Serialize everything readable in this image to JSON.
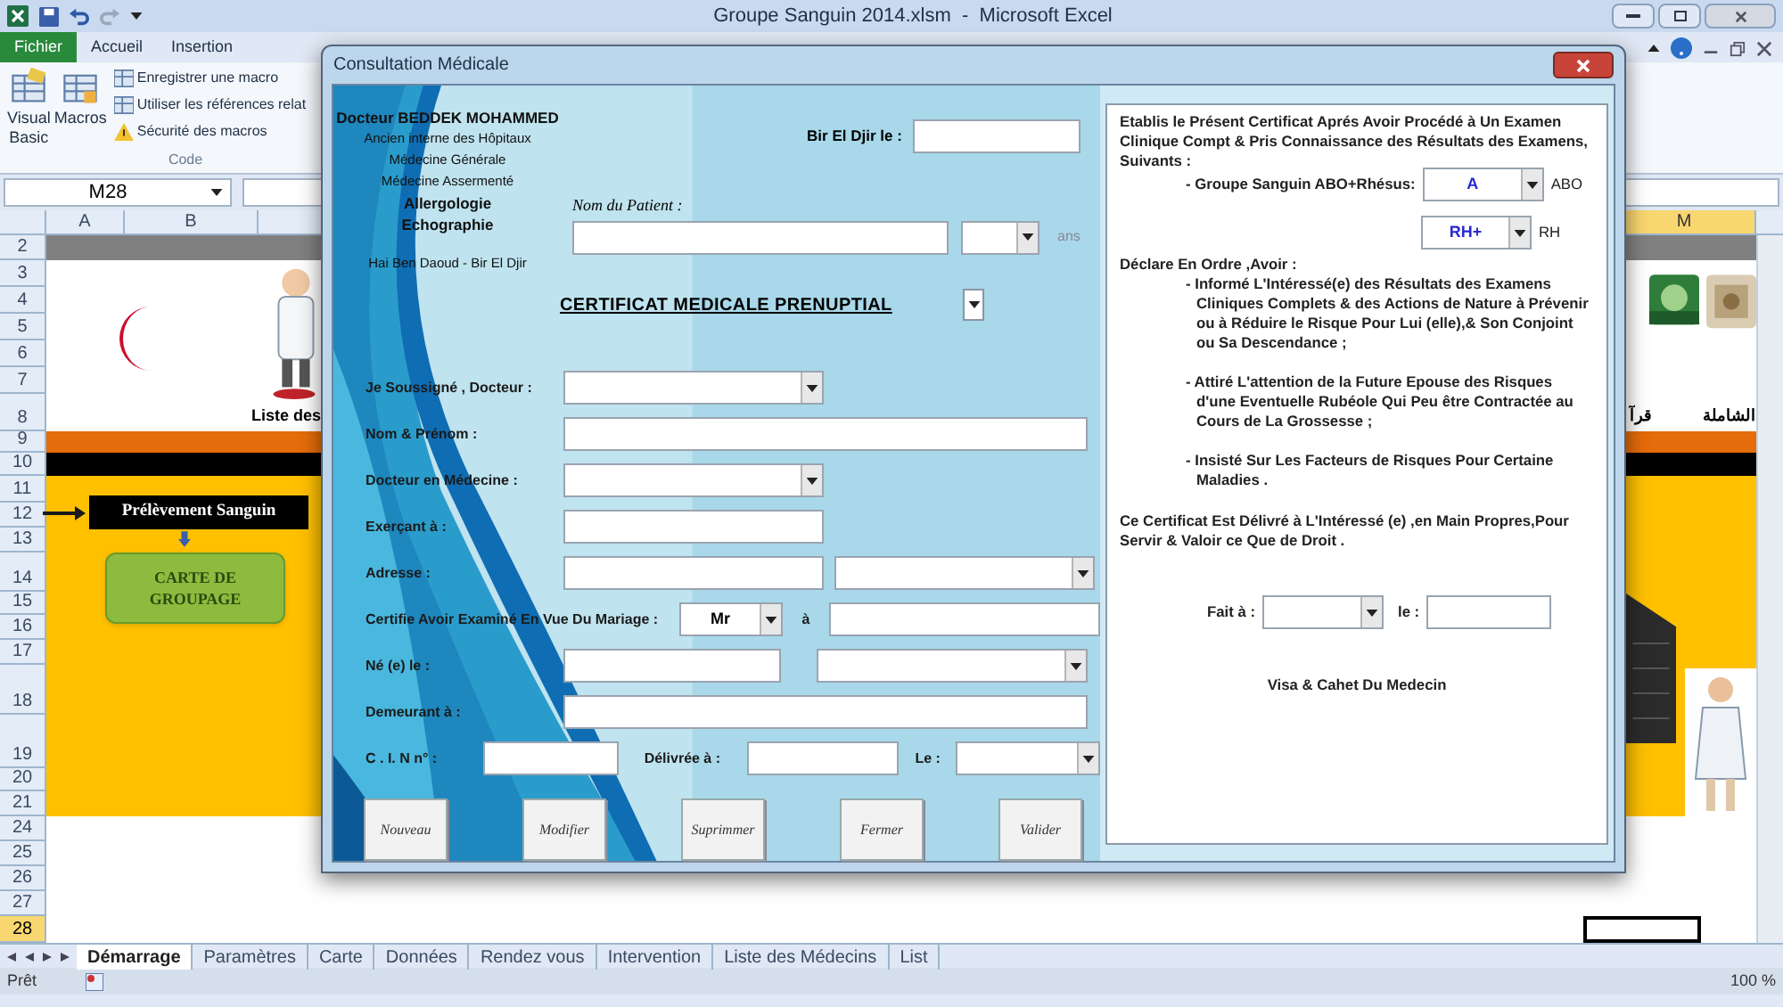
{
  "window": {
    "title": "Groupe Sanguin 2014.xlsm  -  Microsoft Excel"
  },
  "ribbon_tabs": [
    {
      "label": "Fichier",
      "selected": true
    },
    {
      "label": "Accueil",
      "selected": false
    },
    {
      "label": "Insertion",
      "selected": false
    }
  ],
  "ribbon": {
    "large_buttons": [
      "Visual Basic",
      "Macros"
    ],
    "small_buttons": [
      "Enregistrer une macro",
      "Utiliser les références relat",
      "Sécurité des macros"
    ],
    "group": "Code"
  },
  "name_box": "M28",
  "columns": [
    {
      "label": "A",
      "selected": false
    },
    {
      "label": "B",
      "selected": false
    },
    {
      "label": "M",
      "selected": true
    }
  ],
  "rows": [
    {
      "label": "2",
      "kind": "gray",
      "selected": false
    },
    {
      "label": "3",
      "kind": "white",
      "selected": false
    },
    {
      "label": "4",
      "kind": "white",
      "selected": false
    },
    {
      "label": "5",
      "kind": "white",
      "selected": false
    },
    {
      "label": "6",
      "kind": "white",
      "selected": false
    },
    {
      "label": "7",
      "kind": "white",
      "selected": false
    },
    {
      "label": "8",
      "kind": "white",
      "selected": false
    },
    {
      "label": "9",
      "kind": "orange",
      "selected": false
    },
    {
      "label": "10",
      "kind": "black",
      "selected": false
    },
    {
      "label": "11",
      "kind": "yellow",
      "selected": false
    },
    {
      "label": "12",
      "kind": "yellow",
      "selected": false
    },
    {
      "label": "13",
      "kind": "yellow",
      "selected": false
    },
    {
      "label": "14",
      "kind": "yellow",
      "selected": false
    },
    {
      "label": "15",
      "kind": "yellow",
      "selected": false
    },
    {
      "label": "16",
      "kind": "yellow",
      "selected": false
    },
    {
      "label": "17",
      "kind": "yellow",
      "selected": false
    },
    {
      "label": "18",
      "kind": "yellow",
      "selected": false
    },
    {
      "label": "19",
      "kind": "yellow",
      "selected": false
    },
    {
      "label": "20",
      "kind": "yellow",
      "selected": false
    },
    {
      "label": "21",
      "kind": "yellow",
      "selected": false
    },
    {
      "label": "24",
      "kind": "white",
      "selected": false
    },
    {
      "label": "25",
      "kind": "white",
      "selected": false
    },
    {
      "label": "26",
      "kind": "white",
      "selected": false
    },
    {
      "label": "27",
      "kind": "white",
      "selected": false
    },
    {
      "label": "28",
      "kind": "white",
      "selected": true
    }
  ],
  "sheet": {
    "caption": "Liste des",
    "arabic_labels": [
      "الشاملة",
      "قرآ"
    ],
    "flow_label": "Prélèvement Sanguin",
    "card_button": "CARTE DE GROUPAGE"
  },
  "sheet_tabs": [
    {
      "label": "Démarrage",
      "selected": true
    },
    {
      "label": "Paramètres",
      "selected": false
    },
    {
      "label": "Carte",
      "selected": false
    },
    {
      "label": "Données",
      "selected": false
    },
    {
      "label": "Rendez vous",
      "selected": false
    },
    {
      "label": "Intervention",
      "selected": false
    },
    {
      "label": "Liste des Médecins",
      "selected": false
    },
    {
      "label": "List",
      "selected": false
    }
  ],
  "status_bar": {
    "text": "Prêt",
    "zoom": "100 %"
  },
  "dialog": {
    "title": "Consultation Médicale",
    "doctor_card": [
      {
        "text": "Docteur BEDDEK MOHAMMED",
        "bold": true
      },
      {
        "text": "Ancien interne des Hôpitaux",
        "bold": false
      },
      {
        "text": "Médecine Générale",
        "bold": false
      },
      {
        "text": "Médecine Assermenté",
        "bold": false
      },
      {
        "text": "Allergologie",
        "bold": true
      },
      {
        "text": "Echographie",
        "bold": true
      },
      {
        "text": "Hai Ben Daoud - Bir El Djir",
        "bold": false
      }
    ],
    "date_label": "Bir El Djir le :",
    "patient_label": "Nom du Patient :",
    "age_unit": "ans",
    "certificate_title": "CERTIFICAT MEDICALE PRENUPTIAL",
    "form_rows": [
      {
        "label": "Je Soussigné , Docteur :",
        "controls": [
          {
            "kind": "combo"
          }
        ]
      },
      {
        "label": "Nom & Prénom :",
        "controls": [
          {
            "kind": "text"
          }
        ]
      },
      {
        "label": "Docteur en Médecine  :",
        "controls": [
          {
            "kind": "combo"
          }
        ]
      },
      {
        "label": "Exerçant à  :",
        "controls": [
          {
            "kind": "text"
          }
        ]
      },
      {
        "label": "Adresse  :",
        "controls": [
          {
            "kind": "text"
          },
          {
            "kind": "combo"
          }
        ]
      },
      {
        "label": "Certifie Avoir Examiné En Vue Du Mariage :",
        "controls": [
          {
            "kind": "combo",
            "value": "Mr"
          },
          {
            "kind": "label",
            "text": "à"
          },
          {
            "kind": "text"
          }
        ]
      },
      {
        "label": "Né (e) le  :",
        "controls": [
          {
            "kind": "text"
          },
          {
            "kind": "combo"
          }
        ]
      },
      {
        "label": "Demeurant à  :",
        "controls": [
          {
            "kind": "text"
          }
        ]
      },
      {
        "label": "C . I. N  n°  :",
        "controls": [
          {
            "kind": "text"
          },
          {
            "kind": "label",
            "text": "Délivrée  à  :"
          },
          {
            "kind": "text"
          },
          {
            "kind": "label",
            "text": "Le :"
          },
          {
            "kind": "combo"
          }
        ]
      }
    ],
    "buttons": [
      "Nouveau",
      "Modifier",
      "Suprimmer",
      "Fermer",
      "Valider"
    ],
    "certificate": {
      "intro": "Etablis le Présent Certificat Aprés Avoir Procédé à Un Examen Clinique Compt & Pris Connaissance des Résultats des Examens, Suivants :",
      "blood_label": "- Groupe Sanguin ABO+Rhésus:",
      "abo": {
        "value": "A",
        "unit": "ABO"
      },
      "rh": {
        "value": "RH+",
        "unit": "RH"
      },
      "declare": "Déclare En Ordre ,Avoir :",
      "points": [
        "- Informé L'Intéressé(e) des Résultats des Examens Cliniques Complets & des Actions de Nature à Prévenir ou à Réduire le Risque Pour Lui (elle),& Son Conjoint ou Sa Descendance ;",
        "- Attiré L'attention de la Future Epouse des Risques d'une Eventuelle Rubéole Qui Peu être Contractée au Cours de La Grossesse ;",
        "- Insisté Sur Les Facteurs de Risques Pour Certaine Maladies ."
      ],
      "closing": "Ce Certificat Est Délivré à L'Intéressé (e) ,en Main Propres,Pour Servir & Valoir ce Que de Droit .",
      "place_label": "Fait à :",
      "date_label": "le :",
      "signature": "Visa & Cahet Du Medecin"
    }
  }
}
